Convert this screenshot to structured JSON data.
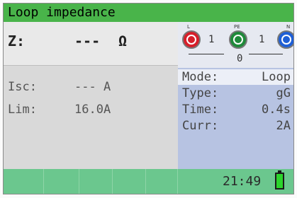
{
  "title": "Loop impedance",
  "measurement": {
    "z_label": "Z:",
    "z_value": "---",
    "z_unit": "Ω",
    "isc_label": "Isc:",
    "isc_value": "--- A",
    "lim_label": "Lim:",
    "lim_value": "16.0A"
  },
  "probes": {
    "l_label": "L",
    "pe_label": "PE",
    "n_label": "N",
    "l_pe_value": "1",
    "pe_n_value": "1",
    "l_n_value": "0",
    "colors": {
      "l": "#d61f2b",
      "pe": "#1f8a3a",
      "n": "#1f5fd6"
    }
  },
  "settings": {
    "mode_label": "Mode:",
    "mode_value": "Loop",
    "type_label": "Type:",
    "type_value": "gG",
    "time_label": "Time:",
    "time_value": "0.4s",
    "curr_label": "Curr:",
    "curr_value": "2A"
  },
  "status": {
    "clock": "21:49",
    "battery_level": 1.0
  }
}
